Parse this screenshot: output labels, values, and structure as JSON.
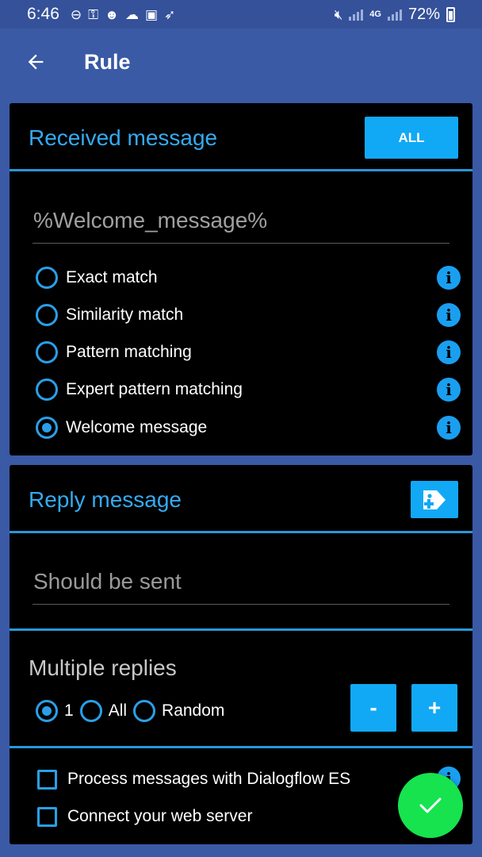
{
  "status_bar": {
    "time": "6:46",
    "left_icons": [
      "do-not-disturb-icon",
      "key-icon",
      "robot-icon",
      "cloud-icon",
      "image-icon",
      "rocket-icon"
    ],
    "right_icons": [
      "mute-icon",
      "signal-icon",
      "4g-icon",
      "signal-icon"
    ],
    "network": "4G",
    "battery": "72%"
  },
  "app_bar": {
    "back_icon": "arrow-left-icon",
    "title": "Rule"
  },
  "received": {
    "title": "Received message",
    "all_button": "ALL",
    "input_value": "%Welcome_message%",
    "options": [
      {
        "label": "Exact match",
        "selected": false
      },
      {
        "label": "Similarity match",
        "selected": false
      },
      {
        "label": "Pattern matching",
        "selected": false
      },
      {
        "label": "Expert pattern matching",
        "selected": false
      },
      {
        "label": "Welcome message",
        "selected": true
      }
    ],
    "info_icon_glyph": "i"
  },
  "reply": {
    "title": "Reply message",
    "tag_icon": "add-tag-icon",
    "input_placeholder": "Should be sent"
  },
  "multiple_replies": {
    "title": "Multiple replies",
    "options": [
      {
        "label": "1",
        "selected": true
      },
      {
        "label": "All",
        "selected": false
      },
      {
        "label": "Random",
        "selected": false
      }
    ],
    "minus_label": "-",
    "plus_label": "+"
  },
  "checks": {
    "dialogflow": "Process messages with Dialogflow ES",
    "webserver": "Connect your web server"
  },
  "fab_icon": "checkmark-icon",
  "colors": {
    "background": "#3a5aa5",
    "card": "#000000",
    "accent": "#11a9f5",
    "accent_text": "#34aaf2",
    "fab": "#16e34e"
  }
}
